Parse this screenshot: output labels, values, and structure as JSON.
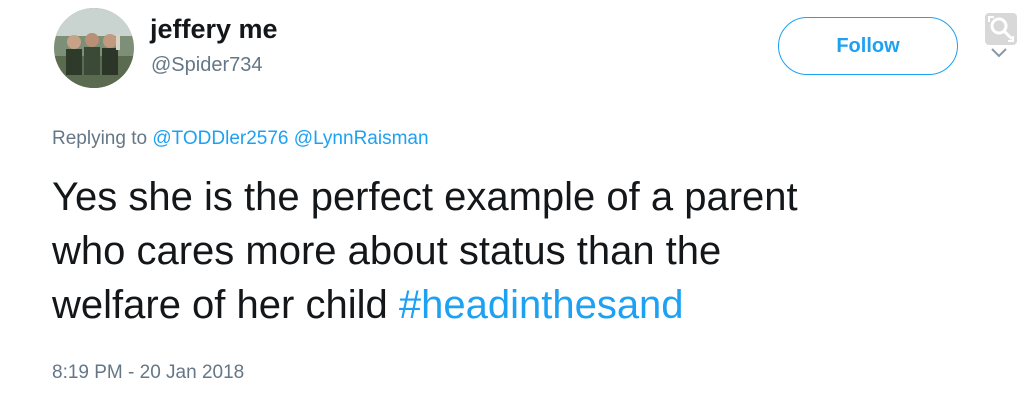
{
  "user": {
    "display_name": "jeffery me",
    "handle": "@Spider734",
    "avatar_icon": "profile-photo"
  },
  "follow_button": {
    "label": "Follow",
    "color": "#1da1f2"
  },
  "reply": {
    "prefix": "Replying to",
    "mentions": [
      "@TODDler2576",
      "@LynnRaisman"
    ]
  },
  "tweet": {
    "text_lines": [
      "Yes she is the perfect example of a parent",
      "who cares more about status than the",
      "welfare of her child "
    ],
    "hashtag": "#headinthesand"
  },
  "timestamp": "8:19 PM - 20 Jan 2018",
  "icons": {
    "extension": "image-search-icon",
    "menu": "chevron-down-icon"
  },
  "colors": {
    "accent": "#1da1f2",
    "text": "#14171a",
    "secondary": "#657786"
  }
}
